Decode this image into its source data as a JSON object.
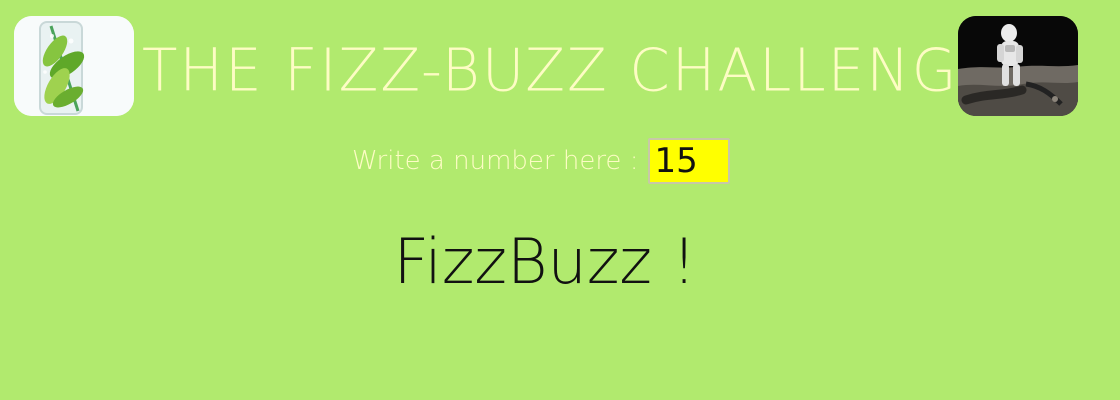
{
  "header": {
    "title": "THE FIZZ-BUZZ CHALLENGE",
    "left_image": "lime-soda-glass-image",
    "right_image": "astronaut-on-moon-image"
  },
  "form": {
    "label": "Write a number here :",
    "value": "15"
  },
  "result": {
    "text": "FizzBuzz !"
  },
  "colors": {
    "background": "#b1ea6e",
    "title": "#fdfcc4",
    "input_background": "#ffff00",
    "result_text": "#111111"
  }
}
